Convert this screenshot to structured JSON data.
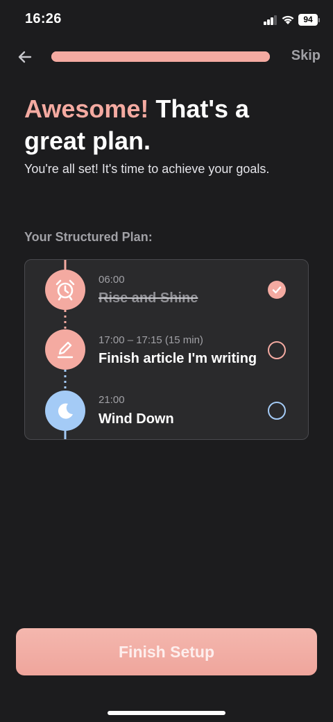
{
  "status_bar": {
    "time": "16:26",
    "battery": "94",
    "signal_bars_filled": 3,
    "signal_bars_total": 4
  },
  "nav": {
    "back_icon": "arrow-left-icon",
    "progress": 1.0,
    "skip_label": "Skip"
  },
  "header": {
    "title_accent": "Awesome!",
    "title_rest": " That's a great plan.",
    "subtitle": "You're all set! It's time to achieve your goals."
  },
  "plan": {
    "section_label": "Your Structured Plan:",
    "items": [
      {
        "time": "06:00",
        "title": "Rise and Shine",
        "icon": "alarm-clock-icon",
        "done": true,
        "color": "#f4aaa1"
      },
      {
        "time": "17:00 – 17:15 (15 min)",
        "title": "Finish article I'm writing",
        "icon": "pencil-icon",
        "done": false,
        "color": "#f4aaa1"
      },
      {
        "time": "21:00",
        "title": "Wind Down",
        "icon": "moon-icon",
        "done": false,
        "color": "#a4cbf6"
      }
    ]
  },
  "footer": {
    "finish_label": "Finish Setup"
  },
  "colors": {
    "background": "#1c1c1e",
    "accent": "#f4aaa1",
    "night": "#a4cbf6",
    "card": "#2a2a2c"
  }
}
